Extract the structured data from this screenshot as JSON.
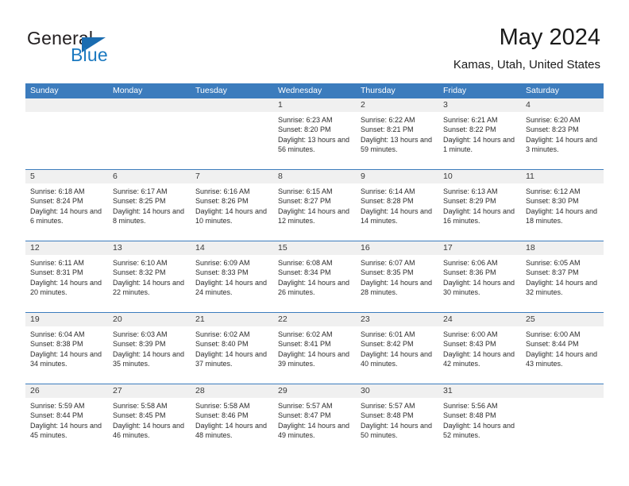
{
  "brand": {
    "name_top": "General",
    "name_bottom": "Blue",
    "triangle_color": "#1b6cb0",
    "blue_text_color": "#1b79c0"
  },
  "header": {
    "title": "May 2024",
    "subtitle": "Kamas, Utah, United States"
  },
  "theme": {
    "header_blue": "#3c7cbd",
    "daynum_band": "#f0f0f0",
    "text": "#2b2b2b"
  },
  "weekdays": [
    "Sunday",
    "Monday",
    "Tuesday",
    "Wednesday",
    "Thursday",
    "Friday",
    "Saturday"
  ],
  "labels": {
    "sunrise": "Sunrise:",
    "sunset": "Sunset:",
    "daylight": "Daylight:"
  },
  "weeks": [
    [
      {
        "day": "",
        "empty": true
      },
      {
        "day": "",
        "empty": true
      },
      {
        "day": "",
        "empty": true
      },
      {
        "day": "1",
        "sunrise": "Sunrise: 6:23 AM",
        "sunset": "Sunset: 8:20 PM",
        "daylight": "Daylight: 13 hours and 56 minutes."
      },
      {
        "day": "2",
        "sunrise": "Sunrise: 6:22 AM",
        "sunset": "Sunset: 8:21 PM",
        "daylight": "Daylight: 13 hours and 59 minutes."
      },
      {
        "day": "3",
        "sunrise": "Sunrise: 6:21 AM",
        "sunset": "Sunset: 8:22 PM",
        "daylight": "Daylight: 14 hours and 1 minute."
      },
      {
        "day": "4",
        "sunrise": "Sunrise: 6:20 AM",
        "sunset": "Sunset: 8:23 PM",
        "daylight": "Daylight: 14 hours and 3 minutes."
      }
    ],
    [
      {
        "day": "5",
        "sunrise": "Sunrise: 6:18 AM",
        "sunset": "Sunset: 8:24 PM",
        "daylight": "Daylight: 14 hours and 6 minutes."
      },
      {
        "day": "6",
        "sunrise": "Sunrise: 6:17 AM",
        "sunset": "Sunset: 8:25 PM",
        "daylight": "Daylight: 14 hours and 8 minutes."
      },
      {
        "day": "7",
        "sunrise": "Sunrise: 6:16 AM",
        "sunset": "Sunset: 8:26 PM",
        "daylight": "Daylight: 14 hours and 10 minutes."
      },
      {
        "day": "8",
        "sunrise": "Sunrise: 6:15 AM",
        "sunset": "Sunset: 8:27 PM",
        "daylight": "Daylight: 14 hours and 12 minutes."
      },
      {
        "day": "9",
        "sunrise": "Sunrise: 6:14 AM",
        "sunset": "Sunset: 8:28 PM",
        "daylight": "Daylight: 14 hours and 14 minutes."
      },
      {
        "day": "10",
        "sunrise": "Sunrise: 6:13 AM",
        "sunset": "Sunset: 8:29 PM",
        "daylight": "Daylight: 14 hours and 16 minutes."
      },
      {
        "day": "11",
        "sunrise": "Sunrise: 6:12 AM",
        "sunset": "Sunset: 8:30 PM",
        "daylight": "Daylight: 14 hours and 18 minutes."
      }
    ],
    [
      {
        "day": "12",
        "sunrise": "Sunrise: 6:11 AM",
        "sunset": "Sunset: 8:31 PM",
        "daylight": "Daylight: 14 hours and 20 minutes."
      },
      {
        "day": "13",
        "sunrise": "Sunrise: 6:10 AM",
        "sunset": "Sunset: 8:32 PM",
        "daylight": "Daylight: 14 hours and 22 minutes."
      },
      {
        "day": "14",
        "sunrise": "Sunrise: 6:09 AM",
        "sunset": "Sunset: 8:33 PM",
        "daylight": "Daylight: 14 hours and 24 minutes."
      },
      {
        "day": "15",
        "sunrise": "Sunrise: 6:08 AM",
        "sunset": "Sunset: 8:34 PM",
        "daylight": "Daylight: 14 hours and 26 minutes."
      },
      {
        "day": "16",
        "sunrise": "Sunrise: 6:07 AM",
        "sunset": "Sunset: 8:35 PM",
        "daylight": "Daylight: 14 hours and 28 minutes."
      },
      {
        "day": "17",
        "sunrise": "Sunrise: 6:06 AM",
        "sunset": "Sunset: 8:36 PM",
        "daylight": "Daylight: 14 hours and 30 minutes."
      },
      {
        "day": "18",
        "sunrise": "Sunrise: 6:05 AM",
        "sunset": "Sunset: 8:37 PM",
        "daylight": "Daylight: 14 hours and 32 minutes."
      }
    ],
    [
      {
        "day": "19",
        "sunrise": "Sunrise: 6:04 AM",
        "sunset": "Sunset: 8:38 PM",
        "daylight": "Daylight: 14 hours and 34 minutes."
      },
      {
        "day": "20",
        "sunrise": "Sunrise: 6:03 AM",
        "sunset": "Sunset: 8:39 PM",
        "daylight": "Daylight: 14 hours and 35 minutes."
      },
      {
        "day": "21",
        "sunrise": "Sunrise: 6:02 AM",
        "sunset": "Sunset: 8:40 PM",
        "daylight": "Daylight: 14 hours and 37 minutes."
      },
      {
        "day": "22",
        "sunrise": "Sunrise: 6:02 AM",
        "sunset": "Sunset: 8:41 PM",
        "daylight": "Daylight: 14 hours and 39 minutes."
      },
      {
        "day": "23",
        "sunrise": "Sunrise: 6:01 AM",
        "sunset": "Sunset: 8:42 PM",
        "daylight": "Daylight: 14 hours and 40 minutes."
      },
      {
        "day": "24",
        "sunrise": "Sunrise: 6:00 AM",
        "sunset": "Sunset: 8:43 PM",
        "daylight": "Daylight: 14 hours and 42 minutes."
      },
      {
        "day": "25",
        "sunrise": "Sunrise: 6:00 AM",
        "sunset": "Sunset: 8:44 PM",
        "daylight": "Daylight: 14 hours and 43 minutes."
      }
    ],
    [
      {
        "day": "26",
        "sunrise": "Sunrise: 5:59 AM",
        "sunset": "Sunset: 8:44 PM",
        "daylight": "Daylight: 14 hours and 45 minutes."
      },
      {
        "day": "27",
        "sunrise": "Sunrise: 5:58 AM",
        "sunset": "Sunset: 8:45 PM",
        "daylight": "Daylight: 14 hours and 46 minutes."
      },
      {
        "day": "28",
        "sunrise": "Sunrise: 5:58 AM",
        "sunset": "Sunset: 8:46 PM",
        "daylight": "Daylight: 14 hours and 48 minutes."
      },
      {
        "day": "29",
        "sunrise": "Sunrise: 5:57 AM",
        "sunset": "Sunset: 8:47 PM",
        "daylight": "Daylight: 14 hours and 49 minutes."
      },
      {
        "day": "30",
        "sunrise": "Sunrise: 5:57 AM",
        "sunset": "Sunset: 8:48 PM",
        "daylight": "Daylight: 14 hours and 50 minutes."
      },
      {
        "day": "31",
        "sunrise": "Sunrise: 5:56 AM",
        "sunset": "Sunset: 8:48 PM",
        "daylight": "Daylight: 14 hours and 52 minutes."
      },
      {
        "day": "",
        "empty": true
      }
    ]
  ]
}
